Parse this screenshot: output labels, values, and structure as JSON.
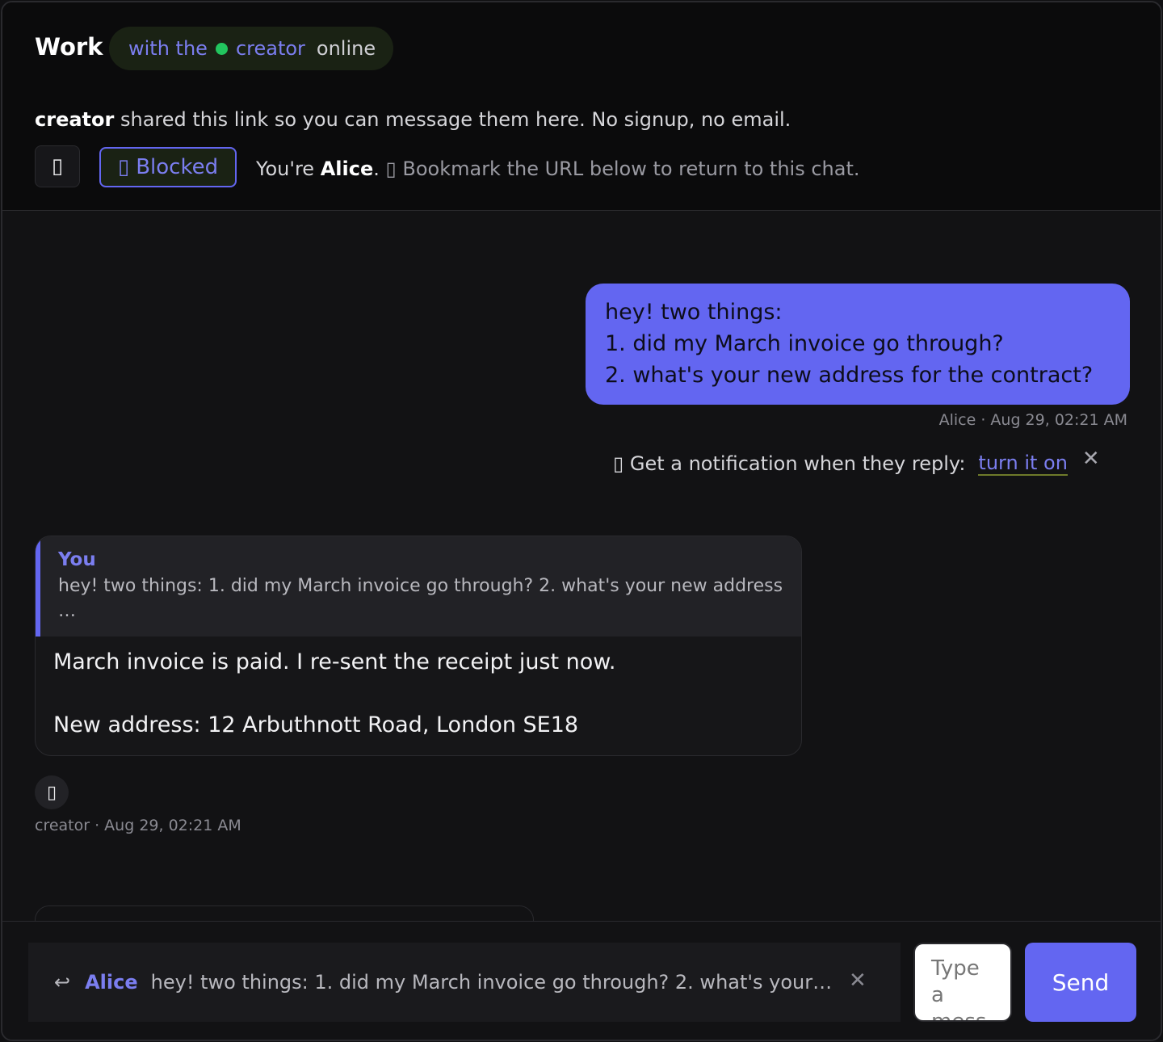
{
  "header": {
    "title": "Work",
    "status": {
      "prefix": "with the",
      "name": "creator",
      "state": "online"
    },
    "intro": {
      "name": "creator",
      "text": " shared this link so you can message them here. No signup, no email."
    },
    "blocked_label": "Blocked",
    "identity": {
      "prefix": "You're ",
      "name": "Alice",
      "suffix": ".",
      "tip": "Bookmark the URL below to return to this chat."
    }
  },
  "messages": {
    "outgoing": {
      "lines": [
        "hey! two things:",
        "1. did my March invoice go through?",
        "2. what's your new address for the contract?"
      ],
      "meta": "Alice · Aug 29, 02:21 AM"
    },
    "notification": {
      "text": "Get a notification when they reply:",
      "link": "turn it on"
    },
    "incoming": {
      "quote_author": "You",
      "quote_text": "hey! two things: 1. did my March invoice go through? 2. what's your new address …",
      "line1": "March invoice is paid. I re-sent the receipt just now.",
      "line2": "New address: 12 Arbuthnott Road, London SE18",
      "meta": "creator · Aug 29, 02:21 AM"
    }
  },
  "composer": {
    "reply_name": "Alice",
    "reply_text": "hey! two things: 1. did my March invoice go through? 2. what's your…",
    "placeholder": "Type a message",
    "send_label": "Send"
  },
  "colors": {
    "accent": "#6366f1",
    "online": "#22c55e",
    "background": "#121214"
  },
  "icons": [
    "chat-icon",
    "block-icon",
    "bookmark-icon",
    "bell-icon",
    "close-icon",
    "reaction-icon",
    "reply-arrow-icon"
  ]
}
